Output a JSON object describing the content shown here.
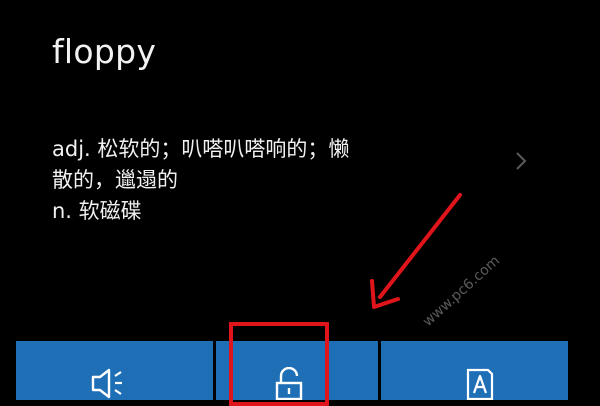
{
  "entry": {
    "word": "floppy",
    "definition_lines": [
      "adj. 松软的；叭嗒叭嗒响的；懒",
      "散的，邋遢的",
      "n. 软磁碟"
    ]
  },
  "actions": {
    "speaker": {
      "icon": "speaker-icon"
    },
    "lock": {
      "icon": "unlock-icon"
    },
    "scan": {
      "icon": "scan-translate-icon"
    }
  },
  "annotations": {
    "arrow_color": "#e0141b",
    "box_color": "#e0141b"
  },
  "watermark": {
    "text": "www.pc6.com"
  },
  "colors": {
    "background": "#000000",
    "text": "#f2f2f2",
    "action_bar": "#1f6fb6"
  }
}
